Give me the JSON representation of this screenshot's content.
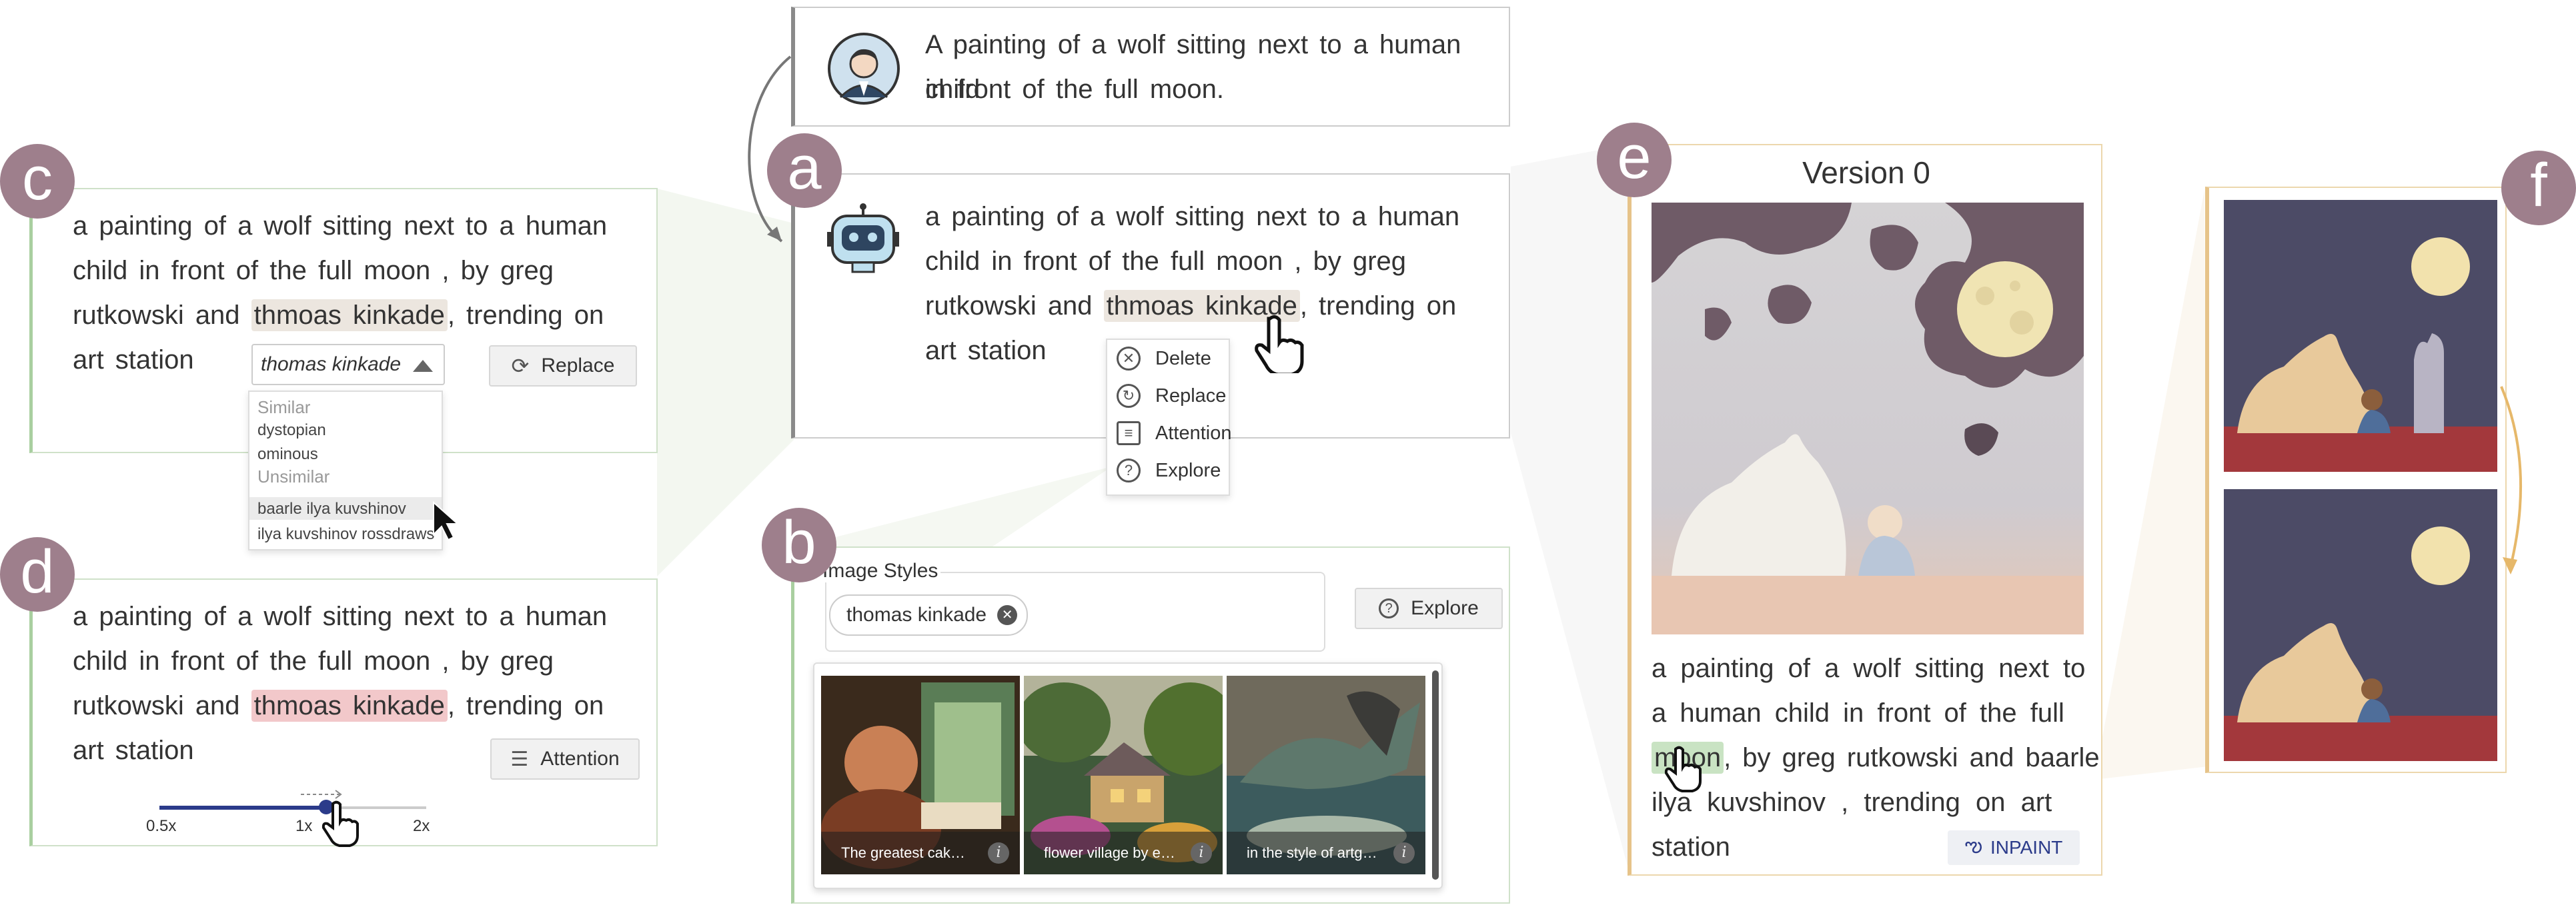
{
  "badges": {
    "a": "a",
    "b": "b",
    "c": "c",
    "d": "d",
    "e": "e",
    "f": "f"
  },
  "user_prompt": {
    "line1": "A painting of a wolf sitting next to a human child",
    "line2": "in front of the full moon."
  },
  "panel_a": {
    "line1": "a painting of a wolf sitting next to a human",
    "line2": "child in front of the full moon , by greg",
    "line3_pre": "rutkowski and ",
    "line3_hl": "thmoas kinkade",
    "line3_post": ", trending on",
    "line4": "art station",
    "menu": [
      "Delete",
      "Replace",
      "Attention",
      "Explore"
    ]
  },
  "panel_c": {
    "line1": "a painting of a wolf sitting next to a human",
    "line2": "child in front of the full moon , by greg",
    "line3_pre": "rutkowski and ",
    "line3_hl": "thmoas kinkade",
    "line3_post": ", trending on",
    "line4": "art station",
    "dropdown_value": "thomas kinkade",
    "replace_label": "Replace",
    "similar_label": "Similar",
    "similar_items": [
      "dystopian",
      "ominous"
    ],
    "unsimilar_label": "Unsimilar",
    "unsimilar_items": [
      "baarle ilya kuvshinov",
      "ilya kuvshinov rossdraws"
    ]
  },
  "panel_d": {
    "line1": "a painting of a wolf sitting next to a human",
    "line2": "child in front of the full moon , by greg",
    "line3_pre": "rutkowski and ",
    "line3_hl": "thmoas kinkade",
    "line3_post": ", trending on",
    "line4": "art station",
    "attention_label": "Attention",
    "slider_ticks": [
      "0.5x",
      "1x",
      "2x"
    ],
    "slider_value": 1.15
  },
  "panel_b": {
    "legend": "Image Styles",
    "chip": "thomas kinkade",
    "explore_label": "Explore",
    "thumbs": [
      {
        "caption": "The greatest cak…"
      },
      {
        "caption": "flower village by e…"
      },
      {
        "caption": "in the style of artg…"
      }
    ]
  },
  "panel_e": {
    "title": "Version 0",
    "line1": "a painting of a wolf sitting next to",
    "line2": "a human child in front of the full",
    "line3_hl": "moon",
    "line3_post": ", by greg rutkowski and baarle",
    "line4": "ilya kuvshinov , trending on art",
    "line5": "station",
    "inpaint_label": "INPAINT"
  },
  "colors": {
    "badge": "#9e7f8c",
    "green_border": "#a9cfa0",
    "grey_border": "#8a8a8a",
    "orange_border": "#e6c389",
    "highlight_grey": "#ece6df",
    "highlight_pink": "#f2c8ca",
    "highlight_green": "#c9e3c3",
    "slider": "#2b3b8a"
  },
  "icons": [
    "user-avatar-icon",
    "robot-avatar-icon",
    "delete-icon",
    "replace-icon",
    "attention-icon",
    "explore-icon",
    "hand-cursor-icon",
    "arrow-cursor-icon",
    "info-icon",
    "inpaint-icon",
    "close-icon"
  ]
}
